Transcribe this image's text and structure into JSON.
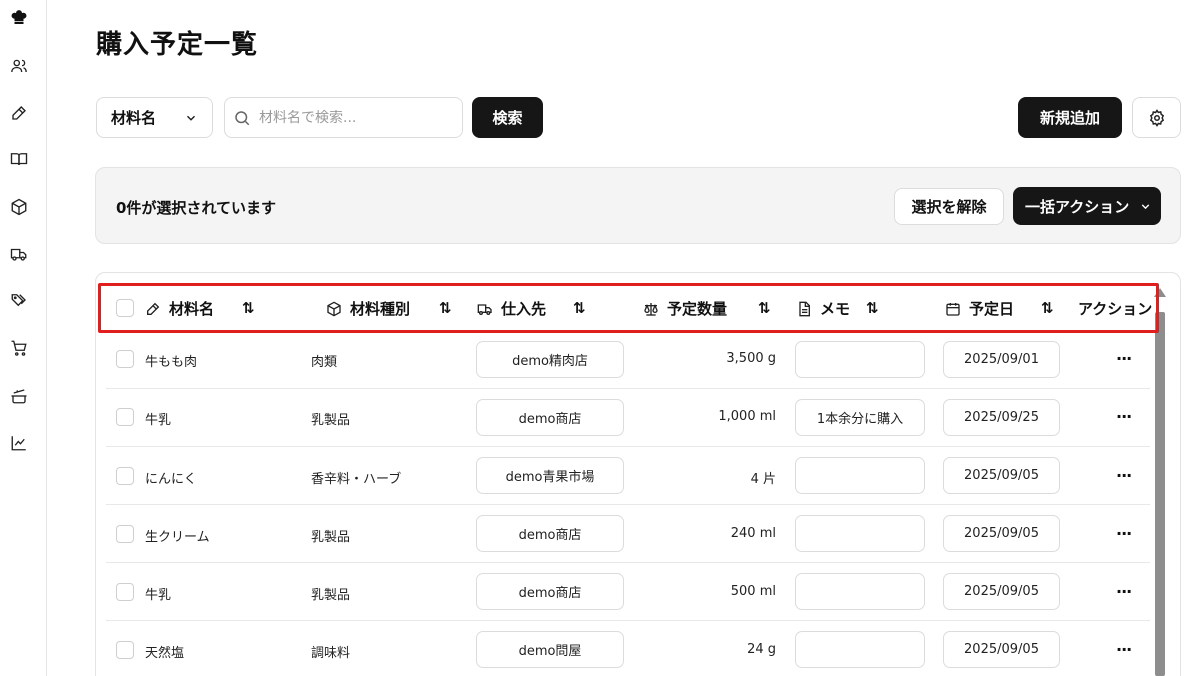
{
  "page": {
    "title": "購入予定一覧"
  },
  "sidebar": {
    "items": [
      {
        "icon": "chef-hat-icon"
      },
      {
        "icon": "users-icon"
      },
      {
        "icon": "pen-icon"
      },
      {
        "icon": "book-icon"
      },
      {
        "icon": "box-icon"
      },
      {
        "icon": "truck-icon"
      },
      {
        "icon": "tags-icon"
      },
      {
        "icon": "cart-icon"
      },
      {
        "icon": "cooking-pot-icon"
      },
      {
        "icon": "chart-icon"
      }
    ]
  },
  "toolbar": {
    "field_select": "材料名",
    "search_placeholder": "材料名で検索...",
    "search_button": "検索",
    "new_button": "新規追加"
  },
  "selection": {
    "text": "0件が選択されています",
    "clear_button": "選択を解除",
    "bulk_button": "一括アクション"
  },
  "table": {
    "headers": {
      "material": "材料名",
      "type": "材料種別",
      "supplier": "仕入先",
      "quantity": "予定数量",
      "memo": "メモ",
      "date": "予定日",
      "actions": "アクション"
    },
    "sort_icon": "⇅",
    "actions_icon": "···",
    "rows": [
      {
        "name": "牛もも肉",
        "type": "肉類",
        "supplier": "demo精肉店",
        "qty": "3,500 g",
        "memo": "",
        "date": "2025/09/01"
      },
      {
        "name": "牛乳",
        "type": "乳製品",
        "supplier": "demo商店",
        "qty": "1,000 ml",
        "memo": "1本余分に購入",
        "date": "2025/09/25"
      },
      {
        "name": "にんにく",
        "type": "香辛料・ハーブ",
        "supplier": "demo青果市場",
        "qty": "4 片",
        "memo": "",
        "date": "2025/09/05"
      },
      {
        "name": "生クリーム",
        "type": "乳製品",
        "supplier": "demo商店",
        "qty": "240 ml",
        "memo": "",
        "date": "2025/09/05"
      },
      {
        "name": "牛乳",
        "type": "乳製品",
        "supplier": "demo商店",
        "qty": "500 ml",
        "memo": "",
        "date": "2025/09/05"
      },
      {
        "name": "天然塩",
        "type": "調味料",
        "supplier": "demo問屋",
        "qty": "24 g",
        "memo": "",
        "date": "2025/09/05"
      }
    ]
  }
}
